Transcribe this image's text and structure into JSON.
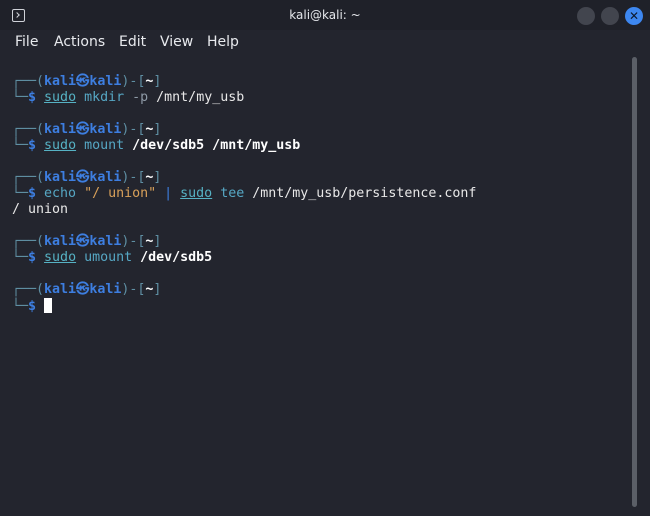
{
  "window": {
    "title": "kali@kali: ~",
    "close_glyph": "✕"
  },
  "menu": [
    "File",
    "Actions",
    "Edit",
    "View",
    "Help"
  ],
  "terminal": {
    "lines": [
      [
        {
          "t": "┌──(",
          "c": "frame"
        },
        {
          "t": "kali㉿kali",
          "c": "user"
        },
        {
          "t": ")-[",
          "c": "frame"
        },
        {
          "t": "~",
          "c": "dir"
        },
        {
          "t": "]",
          "c": "frame"
        }
      ],
      [
        {
          "t": "└─",
          "c": "frame"
        },
        {
          "t": "$",
          "c": "user"
        },
        {
          "t": " ",
          "c": "out"
        },
        {
          "t": "sudo",
          "c": "sudo"
        },
        {
          "t": " mkdir",
          "c": "cmd"
        },
        {
          "t": " -p",
          "c": "opt"
        },
        {
          "t": " /mnt/my_usb",
          "c": "path"
        }
      ],
      [],
      [
        {
          "t": "┌──(",
          "c": "frame"
        },
        {
          "t": "kali㉿kali",
          "c": "user"
        },
        {
          "t": ")-[",
          "c": "frame"
        },
        {
          "t": "~",
          "c": "dir"
        },
        {
          "t": "]",
          "c": "frame"
        }
      ],
      [
        {
          "t": "└─",
          "c": "frame"
        },
        {
          "t": "$",
          "c": "user"
        },
        {
          "t": " ",
          "c": "out"
        },
        {
          "t": "sudo",
          "c": "sudo"
        },
        {
          "t": " mount",
          "c": "cmd"
        },
        {
          "t": " /dev/sdb5 /mnt/my_usb",
          "c": "bold"
        }
      ],
      [],
      [
        {
          "t": "┌──(",
          "c": "frame"
        },
        {
          "t": "kali㉿kali",
          "c": "user"
        },
        {
          "t": ")-[",
          "c": "frame"
        },
        {
          "t": "~",
          "c": "dir"
        },
        {
          "t": "]",
          "c": "frame"
        }
      ],
      [
        {
          "t": "└─",
          "c": "frame"
        },
        {
          "t": "$",
          "c": "user"
        },
        {
          "t": " echo",
          "c": "cmd"
        },
        {
          "t": " \"/ union\"",
          "c": "str"
        },
        {
          "t": " |",
          "c": "pipe"
        },
        {
          "t": " ",
          "c": "out"
        },
        {
          "t": "sudo",
          "c": "sudo"
        },
        {
          "t": " tee",
          "c": "cmd"
        },
        {
          "t": " /mnt/my_usb/persistence.conf",
          "c": "path"
        }
      ],
      [
        {
          "t": "/ union",
          "c": "out"
        }
      ],
      [],
      [
        {
          "t": "┌──(",
          "c": "frame"
        },
        {
          "t": "kali㉿kali",
          "c": "user"
        },
        {
          "t": ")-[",
          "c": "frame"
        },
        {
          "t": "~",
          "c": "dir"
        },
        {
          "t": "]",
          "c": "frame"
        }
      ],
      [
        {
          "t": "└─",
          "c": "frame"
        },
        {
          "t": "$",
          "c": "user"
        },
        {
          "t": " ",
          "c": "out"
        },
        {
          "t": "sudo",
          "c": "sudo"
        },
        {
          "t": " umount",
          "c": "cmd"
        },
        {
          "t": " /dev/sdb5",
          "c": "bold"
        }
      ],
      [],
      [
        {
          "t": "┌──(",
          "c": "frame"
        },
        {
          "t": "kali㉿kali",
          "c": "user"
        },
        {
          "t": ")-[",
          "c": "frame"
        },
        {
          "t": "~",
          "c": "dir"
        },
        {
          "t": "]",
          "c": "frame"
        }
      ],
      [
        {
          "t": "└─",
          "c": "frame"
        },
        {
          "t": "$",
          "c": "user"
        },
        {
          "t": " ",
          "c": "out"
        },
        {
          "t": "",
          "c": "cursor"
        }
      ]
    ]
  }
}
